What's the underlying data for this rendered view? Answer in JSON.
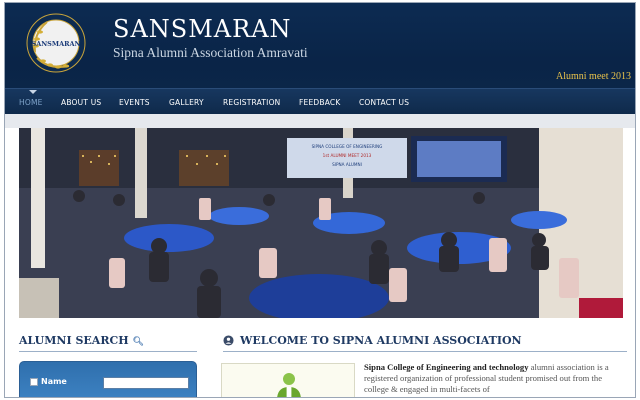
{
  "site": {
    "title": "SANSMARAN",
    "subtitle": "Sipna Alumni Association Amravati",
    "tagline": "Alumni meet 2013",
    "logo_text": "SANSMARAN",
    "logo_ring_text": "Sipna College of Engg. & Technology"
  },
  "nav": {
    "items": [
      {
        "label": "HOME",
        "active": true
      },
      {
        "label": "ABOUT US"
      },
      {
        "label": "EVENTS"
      },
      {
        "label": "GALLERY"
      },
      {
        "label": "REGISTRATION"
      },
      {
        "label": "FEEDBACK"
      },
      {
        "label": "CONTACT US"
      }
    ]
  },
  "hero": {
    "banner_title": "SIPNA COLLEGE OF ENGINEERING",
    "banner_line2": "1st ALUMNI MEET 2013",
    "banner_line3": "SIPNA ALUMNI"
  },
  "alumni_search": {
    "title": "ALUMNI SEARCH",
    "icon": "search-icon",
    "name_label": "Name",
    "name_value": ""
  },
  "welcome": {
    "title": "WELCOME TO SIPNA ALUMNI ASSOCIATION",
    "icon": "person-circle-icon",
    "intro_bold": "Sipna College of Engineering and technology",
    "intro_rest": " alumni association is a registered organization of professional student promised out from the college & engaged in multi-facets of"
  },
  "colors": {
    "header_bg": "#0b2649",
    "nav_bg": "#15335a",
    "accent_gold": "#e9c34b",
    "section_title": "#1f3a63",
    "search_box": "#3579b8"
  }
}
